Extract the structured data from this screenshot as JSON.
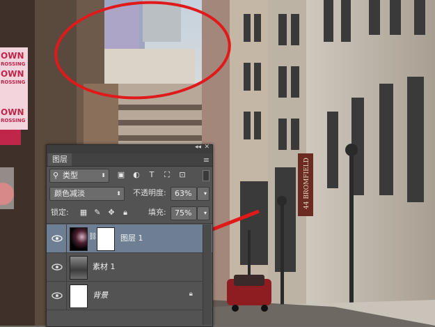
{
  "panel": {
    "tab_label": "图层",
    "collapse_glyph": "◂◂",
    "close_glyph": "✕",
    "filter": {
      "label": "类型",
      "icon": "search-icon"
    },
    "blend_mode": "颜色减淡",
    "opacity": {
      "label": "不透明度:",
      "value": "63%"
    },
    "lock": {
      "label": "锁定:"
    },
    "fill": {
      "label": "填充:",
      "value": "75%"
    },
    "layers": [
      {
        "name": "图层 1",
        "visible": true,
        "selected": true,
        "has_mask": true
      },
      {
        "name": "素材 1",
        "visible": true,
        "selected": false,
        "has_mask": false
      },
      {
        "name": "背景",
        "visible": true,
        "selected": false,
        "locked": true
      }
    ]
  },
  "scene": {
    "store_sign": "44 BROMFIELD",
    "pink_banner_lines": [
      "OWN",
      "ROSSING",
      "OWN",
      "ROSSING",
      "OWN",
      "ROSSING"
    ],
    "annotation_color": "#e0191a"
  }
}
